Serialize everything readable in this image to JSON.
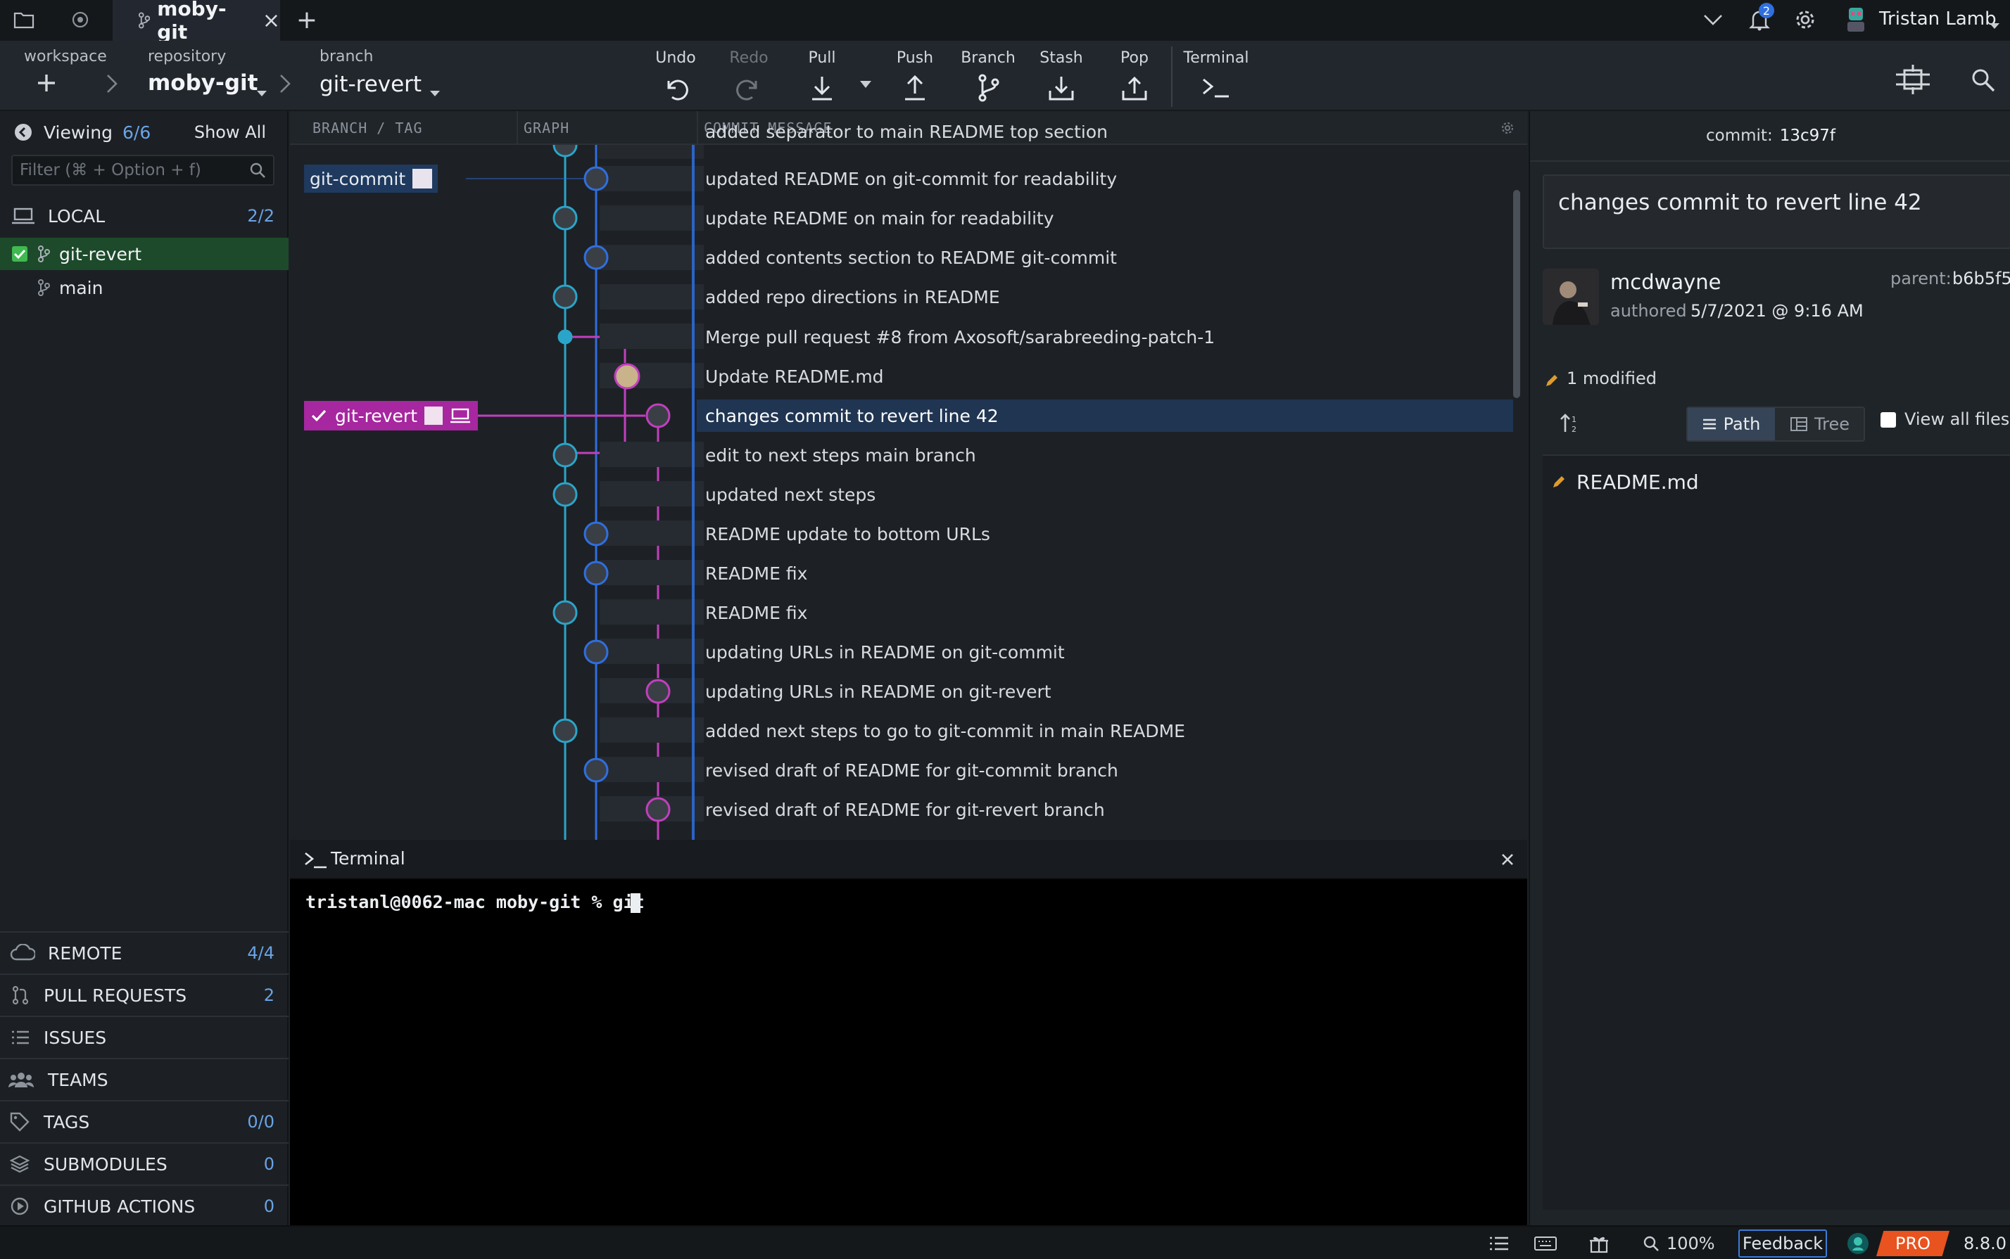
{
  "tabbar": {
    "repo_tab_name": "moby-git",
    "close_glyph": "×",
    "add_glyph": "+",
    "notification_count": "2",
    "user_name": "Tristan Lamb"
  },
  "toolbar": {
    "workspace_label": "workspace",
    "repository_label": "repository",
    "repository_value": "moby-git",
    "branch_label": "branch",
    "branch_value": "git-revert",
    "undo": "Undo",
    "redo": "Redo",
    "pull": "Pull",
    "push": "Push",
    "branch": "Branch",
    "stash": "Stash",
    "pop": "Pop",
    "terminal": "Terminal"
  },
  "left": {
    "viewing_label": "Viewing",
    "viewing_count": "6/6",
    "show_all": "Show All",
    "filter_placeholder": "Filter (⌘ + Option + f)",
    "local_label": "LOCAL",
    "local_count": "2/2",
    "branches": [
      "git-revert",
      "main"
    ],
    "sections": [
      {
        "label": "REMOTE",
        "count": "4/4"
      },
      {
        "label": "PULL REQUESTS",
        "count": "2"
      },
      {
        "label": "ISSUES",
        "count": ""
      },
      {
        "label": "TEAMS",
        "count": ""
      },
      {
        "label": "TAGS",
        "count": "0/0"
      },
      {
        "label": "SUBMODULES",
        "count": "0"
      },
      {
        "label": "GITHUB ACTIONS",
        "count": "0"
      }
    ]
  },
  "graph": {
    "col_branch": "BRANCH / TAG",
    "col_graph": "GRAPH",
    "col_message": "COMMIT MESSAGE",
    "tag_git_commit": "git-commit",
    "tag_git_revert": "git-revert",
    "commits": [
      "added separator to main README top section",
      "updated README on git-commit for readability",
      "update README on main for readability",
      "added contents section to README git-commit",
      "added repo directions in README",
      "Merge pull request #8 from Axosoft/sarabreeding-patch-1",
      "Update README.md",
      "changes commit to revert line 42",
      "edit to next steps main branch",
      "updated next steps",
      "README update to bottom URLs",
      "README fix",
      "README fix",
      "updating URLs in README on git-commit",
      "updating URLs in README on git-revert",
      "added next steps to go to git-commit in main README",
      "revised draft of README for git-commit branch",
      "revised draft of README for git-revert branch"
    ],
    "colors": {
      "main": "#2aa5c9",
      "commit": "#2f6fe0",
      "revert": "#c23fbe",
      "selected": "#203552"
    }
  },
  "terminal": {
    "title": "Terminal",
    "prompt": "tristanl@0062-mac moby-git % git "
  },
  "right": {
    "commit_label": "commit:",
    "commit_sha": "13c97f",
    "summary": "changes commit to revert line 42",
    "author": "mcdwayne",
    "authored_label": "authored",
    "authored_date": "5/7/2021 @ 9:16 AM",
    "parent_label": "parent:",
    "parent_sha": "b6b5f5",
    "modified": "1 modified",
    "path_tab": "Path",
    "tree_tab": "Tree",
    "view_all": "View all files",
    "file": "README.md"
  },
  "status": {
    "zoom": "100%",
    "feedback": "Feedback",
    "pro": "PRO",
    "version": "8.8.0"
  }
}
